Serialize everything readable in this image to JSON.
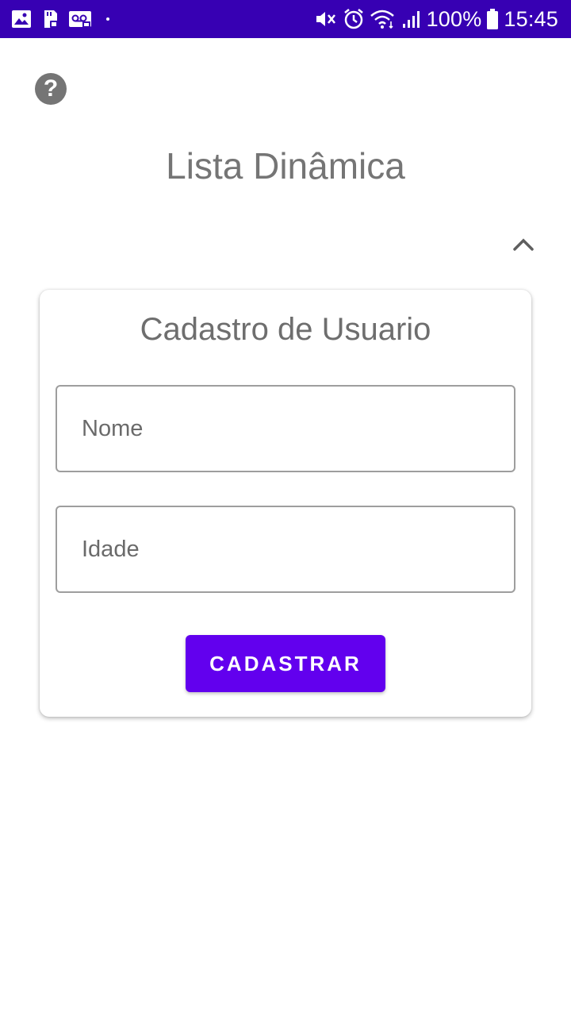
{
  "status_bar": {
    "background": "#3700b3",
    "left_icons": [
      "image-icon",
      "sd-card-icon",
      "voicemail-icon"
    ],
    "right_icons": [
      "mute-icon",
      "alarm-icon",
      "wifi-icon",
      "signal-icon",
      "battery-icon"
    ],
    "battery": "100%",
    "time": "15:45"
  },
  "header": {
    "help_icon": "help-icon",
    "title": "Lista Dinâmica",
    "collapse_icon": "chevron-up-icon"
  },
  "form": {
    "title": "Cadastro de Usuario",
    "name_placeholder": "Nome",
    "age_placeholder": "Idade",
    "submit_label": "CADASTRAR",
    "accent": "#6200ee"
  }
}
